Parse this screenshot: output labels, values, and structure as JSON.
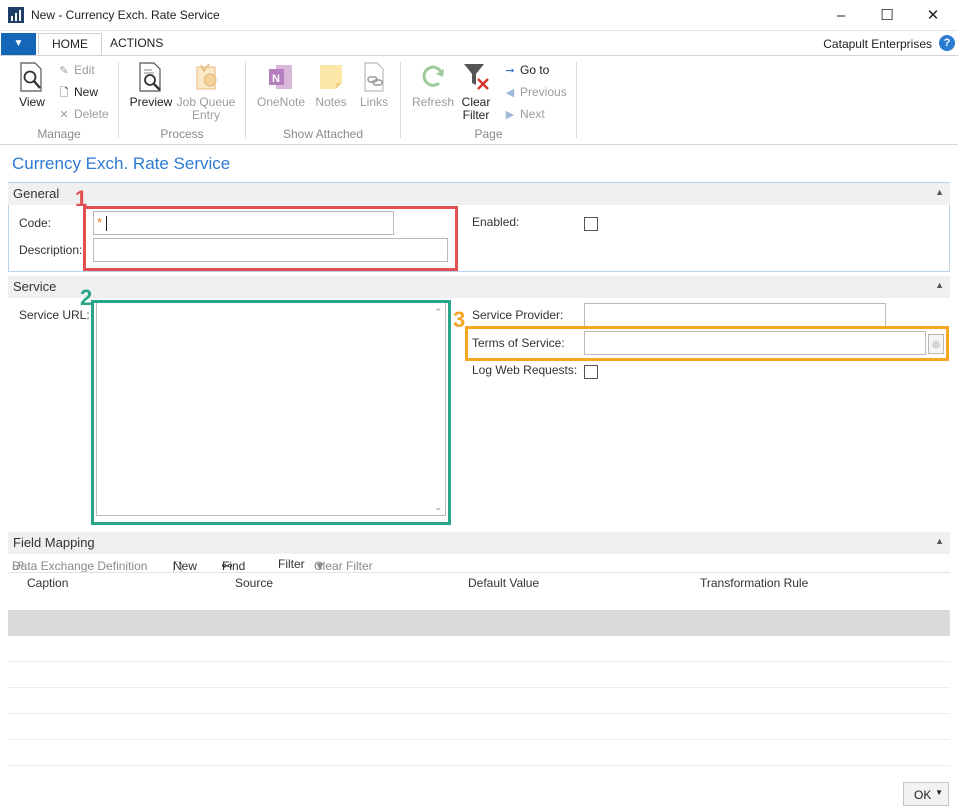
{
  "window": {
    "title": "New - Currency Exch. Rate Service"
  },
  "ribbon": {
    "tabs": [
      "HOME",
      "ACTIONS"
    ],
    "company": "Catapult Enterprises",
    "groups": {
      "manage": {
        "label": "Manage",
        "view": "View",
        "edit": "Edit",
        "new": "New",
        "delete": "Delete"
      },
      "process": {
        "label": "Process",
        "preview": "Preview",
        "job_queue_1": "Job Queue",
        "job_queue_2": "Entry"
      },
      "show_attached": {
        "label": "Show Attached",
        "onenote": "OneNote",
        "notes": "Notes",
        "links": "Links"
      },
      "page": {
        "label": "Page",
        "refresh": "Refresh",
        "clear_filter_1": "Clear",
        "clear_filter_2": "Filter",
        "go_to": "Go to",
        "previous": "Previous",
        "next": "Next"
      }
    }
  },
  "page_title": "Currency Exch. Rate Service",
  "general": {
    "header": "General",
    "code_label": "Code:",
    "code_value": "",
    "required_marker": "*",
    "description_label": "Description:",
    "description_value": "",
    "enabled_label": "Enabled:",
    "enabled": false
  },
  "service": {
    "header": "Service",
    "url_label": "Service URL:",
    "url_value": "",
    "provider_label": "Service Provider:",
    "provider_value": "",
    "terms_label": "Terms of Service:",
    "terms_value": "",
    "log_label": "Log Web Requests:",
    "log_enabled": false
  },
  "annotations": [
    "1",
    "2",
    "3"
  ],
  "field_mapping": {
    "header": "Field Mapping",
    "toolbar": {
      "data_exchange_def": "Data Exchange Definition",
      "new": "New",
      "find": "Find",
      "filter": "Filter",
      "clear_filter": "Clear Filter"
    },
    "columns": [
      "Caption",
      "Source",
      "Default Value",
      "Transformation Rule"
    ],
    "rows": []
  },
  "footer": {
    "ok_label": "OK"
  },
  "colors": {
    "accent_blue": "#2d7ad3",
    "annotation_red": "#e05050",
    "annotation_green": "#2aa58a",
    "annotation_orange": "#f5a623"
  }
}
